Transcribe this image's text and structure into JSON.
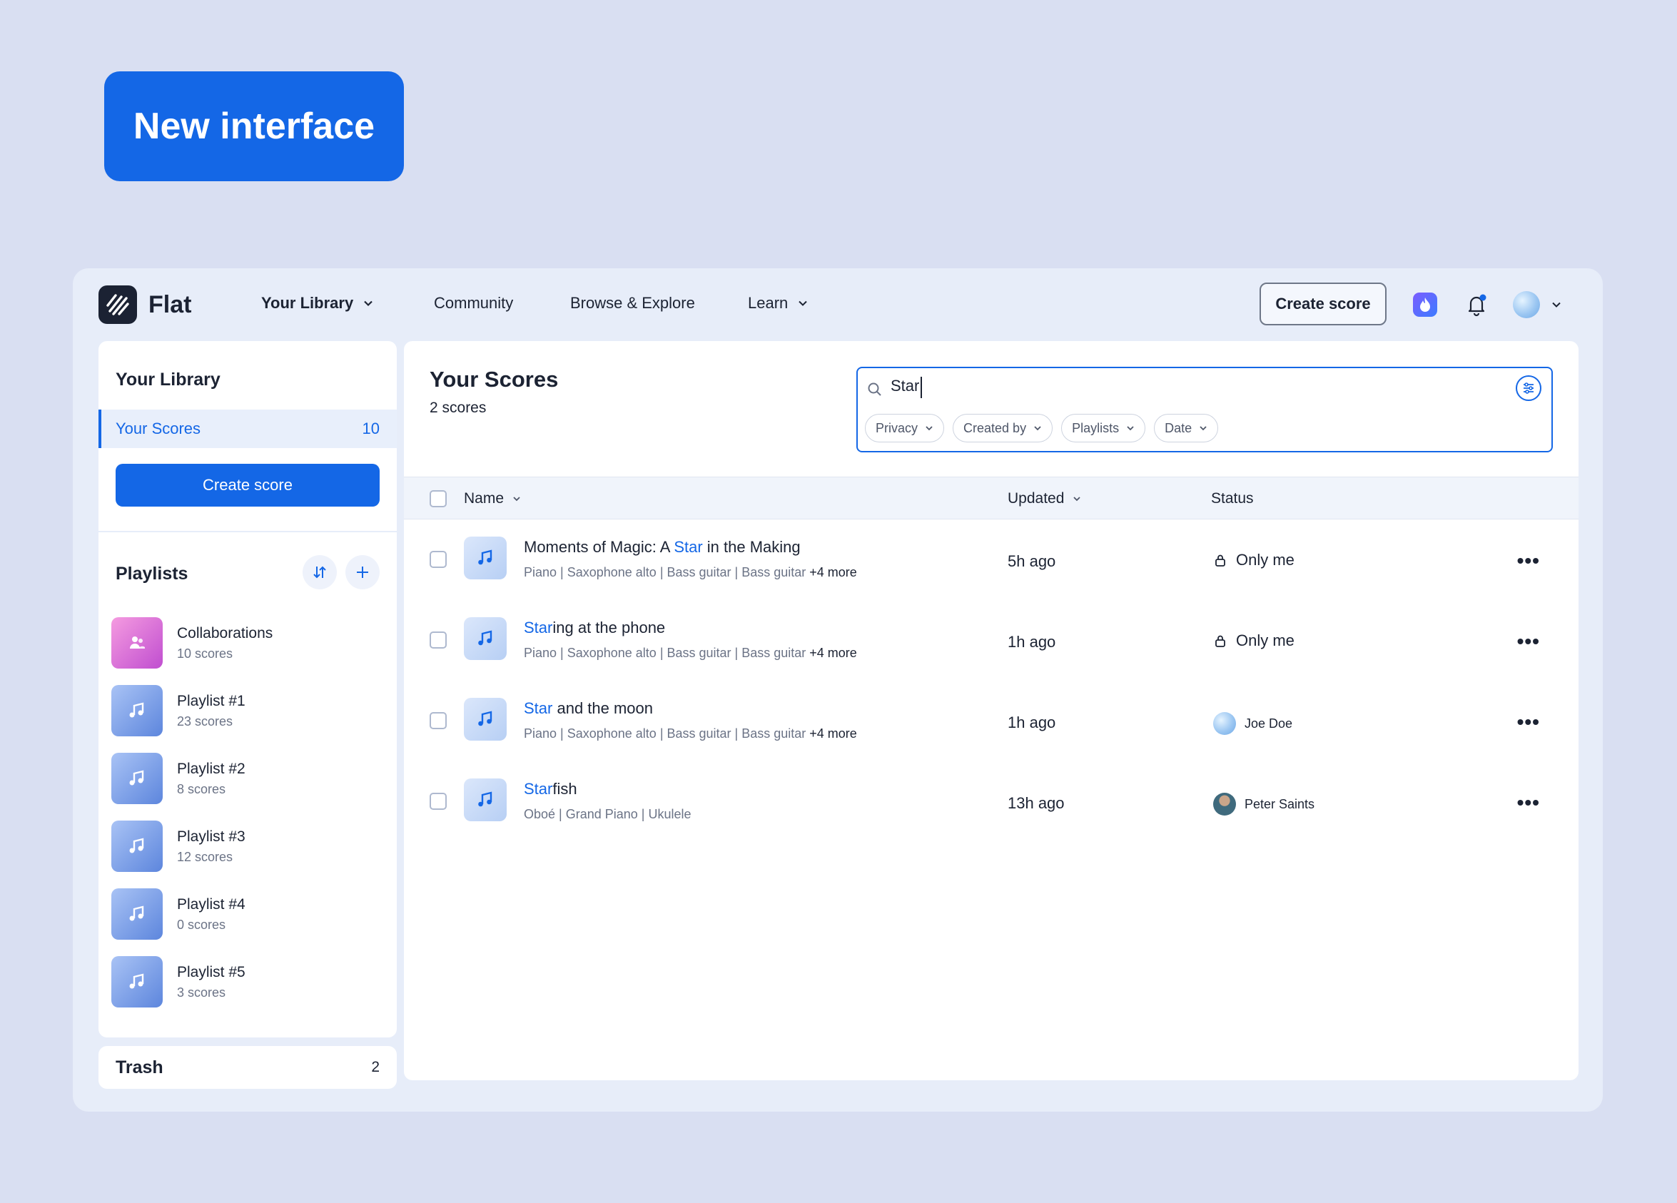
{
  "banner": {
    "label": "New interface"
  },
  "nav": {
    "logo": "Flat",
    "items": [
      "Your Library",
      "Community",
      "Browse & Explore",
      "Learn"
    ],
    "create_label": "Create score"
  },
  "sidebar": {
    "title": "Your Library",
    "scores_label": "Your Scores",
    "scores_count": "10",
    "create_label": "Create score",
    "playlists_title": "Playlists",
    "playlists": [
      {
        "name": "Collaborations",
        "sub": "10 scores"
      },
      {
        "name": "Playlist #1",
        "sub": "23 scores"
      },
      {
        "name": "Playlist #2",
        "sub": "8 scores"
      },
      {
        "name": "Playlist #3",
        "sub": "12 scores"
      },
      {
        "name": "Playlist #4",
        "sub": "0 scores"
      },
      {
        "name": "Playlist #5",
        "sub": "3 scores"
      }
    ],
    "trash_label": "Trash",
    "trash_count": "2"
  },
  "main": {
    "title": "Your Scores",
    "subtitle": "2 scores",
    "search_value": "Star",
    "filters": [
      "Privacy",
      "Created by",
      "Playlists",
      "Date"
    ],
    "columns": {
      "name": "Name",
      "updated": "Updated",
      "status": "Status"
    },
    "rows": [
      {
        "title_pre": "Moments of Magic: A ",
        "title_hl": "Star",
        "title_post": " in the Making",
        "meta": "Piano | Saxophone alto | Bass guitar | Bass guitar",
        "more": "+4 more",
        "updated": "5h ago",
        "status": "Only me"
      },
      {
        "title_pre": "",
        "title_hl": "Star",
        "title_post": "ing at the phone",
        "meta": "Piano | Saxophone alto | Bass guitar | Bass guitar",
        "more": "+4 more",
        "updated": "1h ago",
        "status": "Only me"
      },
      {
        "title_pre": "",
        "title_hl": "Star",
        "title_post": " and the moon",
        "meta": "Piano | Saxophone alto | Bass guitar | Bass guitar",
        "more": "+4 more",
        "updated": "1h ago",
        "status": "Joe Doe"
      },
      {
        "title_pre": "",
        "title_hl": "Star",
        "title_post": "fish",
        "meta": "Oboé | Grand Piano  | Ukulele",
        "more": "",
        "updated": "13h ago",
        "status": "Peter Saints"
      }
    ]
  },
  "colors": {
    "accent": "#1467e6",
    "background": "#d9dff2",
    "panel": "#e7edf9"
  }
}
